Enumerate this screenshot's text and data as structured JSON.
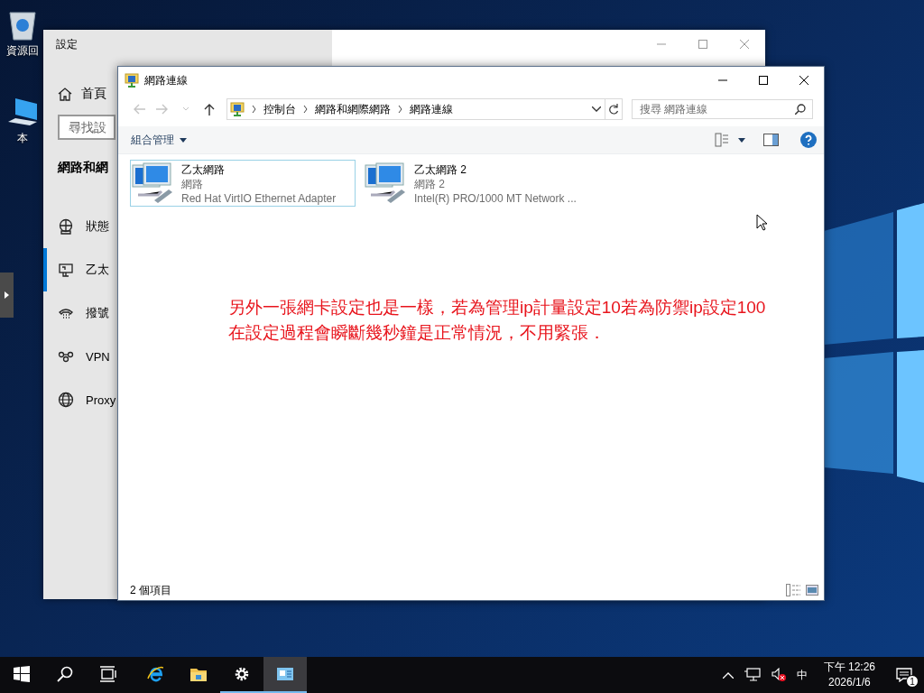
{
  "desktop": {
    "icons": [
      {
        "kind": "recycle-bin",
        "label": "資源回"
      },
      {
        "kind": "computer",
        "label": "本"
      }
    ]
  },
  "settings_window": {
    "title": "設定",
    "home": "首頁",
    "search": {
      "placeholder": "尋找設"
    },
    "section_title": "網路和網",
    "nav_items": [
      {
        "kind": "status",
        "label": "狀態",
        "selected": false
      },
      {
        "kind": "ethernet",
        "label": "乙太",
        "selected": true
      },
      {
        "kind": "dialup",
        "label": "撥號",
        "selected": false
      },
      {
        "kind": "vpn",
        "label": "VPN",
        "selected": false
      },
      {
        "kind": "proxy",
        "label": "Proxy",
        "selected": false
      }
    ]
  },
  "explorer": {
    "title": "網路連線",
    "breadcrumbs": [
      "控制台",
      "網路和網際網路",
      "網路連線"
    ],
    "search": {
      "placeholder": "搜尋 網路連線"
    },
    "organize": "組合管理",
    "items": [
      {
        "name": "乙太網路",
        "network": "網路",
        "adapter": "Red Hat VirtIO Ethernet Adapter",
        "selected": true
      },
      {
        "name": "乙太網路 2",
        "network": "網路 2",
        "adapter": "Intel(R) PRO/1000 MT Network ...",
        "selected": false
      }
    ],
    "annotation": [
      "另外一張網卡設定也是一樣，若為管理ip計量設定10若為防禦ip設定100",
      "在設定過程會瞬斷幾秒鐘是正常情況，不用緊張．"
    ],
    "status": "2 個項目"
  },
  "taskbar": {
    "apps": [
      {
        "kind": "start",
        "running": false,
        "selected": false
      },
      {
        "kind": "search",
        "running": false,
        "selected": false
      },
      {
        "kind": "task-view",
        "running": false,
        "selected": false
      },
      {
        "kind": "browser",
        "running": false,
        "selected": false
      },
      {
        "kind": "folder",
        "running": false,
        "selected": false
      },
      {
        "kind": "settings",
        "running": true,
        "selected": false
      },
      {
        "kind": "network-connections",
        "running": true,
        "selected": true
      }
    ],
    "ime": "中",
    "time": "下午 12:26",
    "date": "2026/1/6",
    "notifications": "1"
  }
}
